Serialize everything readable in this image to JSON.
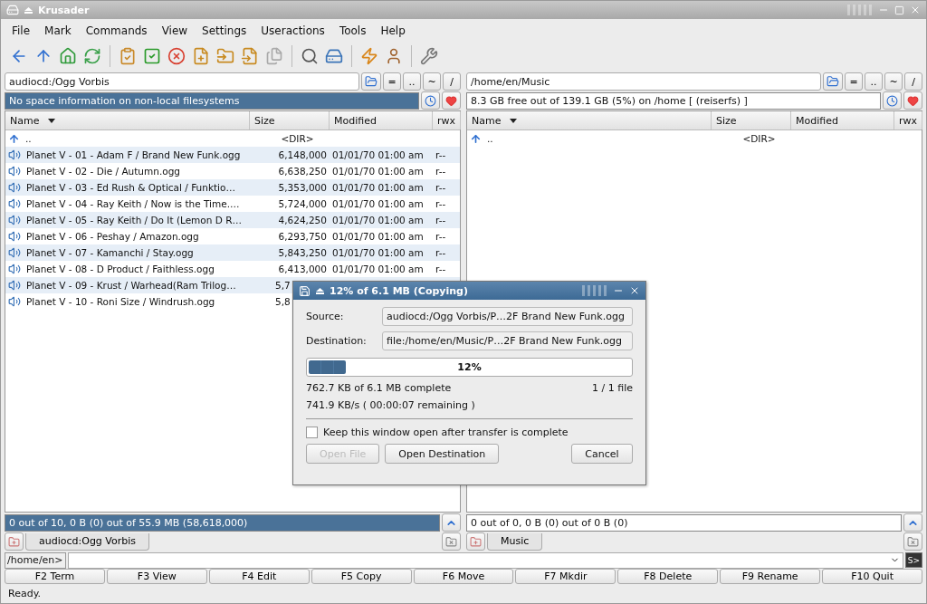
{
  "window": {
    "title": "Krusader"
  },
  "menu": [
    "File",
    "Mark",
    "Commands",
    "View",
    "Settings",
    "Useractions",
    "Tools",
    "Help"
  ],
  "panels": [
    {
      "active": true,
      "path": "audiocd:/Ogg Vorbis",
      "path_buttons": [
        "=",
        "..",
        "~",
        "/"
      ],
      "space": "No space information on non-local filesystems",
      "columns": [
        "Name",
        "Size",
        "Modified",
        "rwx"
      ],
      "rows": [
        {
          "kind": "parent",
          "name": "..",
          "size": "<DIR>"
        },
        {
          "kind": "audio",
          "name": "Planet V - 01 - Adam F / Brand New Funk.ogg",
          "size": "6,148,000",
          "modified": "01/01/70 01:00 am",
          "rwx": "r--"
        },
        {
          "kind": "audio",
          "name": "Planet V - 02 - Die / Autumn.ogg",
          "size": "6,638,250",
          "modified": "01/01/70 01:00 am",
          "rwx": "r--"
        },
        {
          "kind": "audio",
          "name": "Planet V - 03 - Ed Rush & Optical / Funktio…",
          "size": "5,353,000",
          "modified": "01/01/70 01:00 am",
          "rwx": "r--"
        },
        {
          "kind": "audio",
          "name": "Planet V - 04 - Ray Keith / Now is the Time.…",
          "size": "5,724,000",
          "modified": "01/01/70 01:00 am",
          "rwx": "r--"
        },
        {
          "kind": "audio",
          "name": "Planet V - 05 - Ray Keith / Do It (Lemon D R…",
          "size": "4,624,250",
          "modified": "01/01/70 01:00 am",
          "rwx": "r--"
        },
        {
          "kind": "audio",
          "name": "Planet V - 06 - Peshay / Amazon.ogg",
          "size": "6,293,750",
          "modified": "01/01/70 01:00 am",
          "rwx": "r--"
        },
        {
          "kind": "audio",
          "name": "Planet V - 07 - Kamanchi / Stay.ogg",
          "size": "5,843,250",
          "modified": "01/01/70 01:00 am",
          "rwx": "r--"
        },
        {
          "kind": "audio",
          "name": "Planet V - 08 - D Product / Faithless.ogg",
          "size": "6,413,000",
          "modified": "01/01/70 01:00 am",
          "rwx": "r--"
        },
        {
          "kind": "audio",
          "name": "Planet V - 09 - Krust / Warhead(Ram Trilog…",
          "size": "5,7"
        },
        {
          "kind": "audio",
          "name": "Planet V - 10 - Roni Size / Windrush.ogg",
          "size": "5,8"
        }
      ],
      "status": "0 out of 10, 0 B (0) out of 55.9 MB (58,618,000)",
      "tab": "audiocd:Ogg Vorbis"
    },
    {
      "active": false,
      "path": "/home/en/Music",
      "path_buttons": [
        "=",
        "..",
        "~",
        "/"
      ],
      "space": "8.3 GB free out of 139.1 GB (5%) on /home [ (reiserfs) ]",
      "columns": [
        "Name",
        "Size",
        "Modified",
        "rwx"
      ],
      "rows": [
        {
          "kind": "parent",
          "name": "..",
          "size": "<DIR>"
        }
      ],
      "status": "0 out of 0, 0 B (0) out of 0 B (0)",
      "tab": "Music"
    }
  ],
  "command_line": {
    "prompt": "/home/en>",
    "terminal_button": "S>"
  },
  "function_keys": [
    "F2 Term",
    "F3 View",
    "F4 Edit",
    "F5 Copy",
    "F6 Move",
    "F7 Mkdir",
    "F8 Delete",
    "F9 Rename",
    "F10 Quit"
  ],
  "status_bar": "Ready.",
  "dialog": {
    "title": "12% of 6.1 MB  (Copying)",
    "source_label": "Source:",
    "source": "audiocd:/Ogg Vorbis/P…2F Brand New Funk.ogg",
    "destination_label": "Destination:",
    "destination": "file:/home/en/Music/P…2F Brand New Funk.ogg",
    "progress": {
      "level": 0.12,
      "text": "12%"
    },
    "done": "762.7 KB of 6.1 MB complete",
    "files": "1 / 1 file",
    "speed": "741.9 KB/s ( 00:00:07 remaining )",
    "keep_open": {
      "label": "Keep this window open after transfer is complete",
      "checked": false
    },
    "buttons": [
      {
        "label": "Open File",
        "disabled": true
      },
      {
        "label": "Open Destination",
        "disabled": false
      },
      {
        "label": "Cancel",
        "disabled": false
      }
    ]
  }
}
